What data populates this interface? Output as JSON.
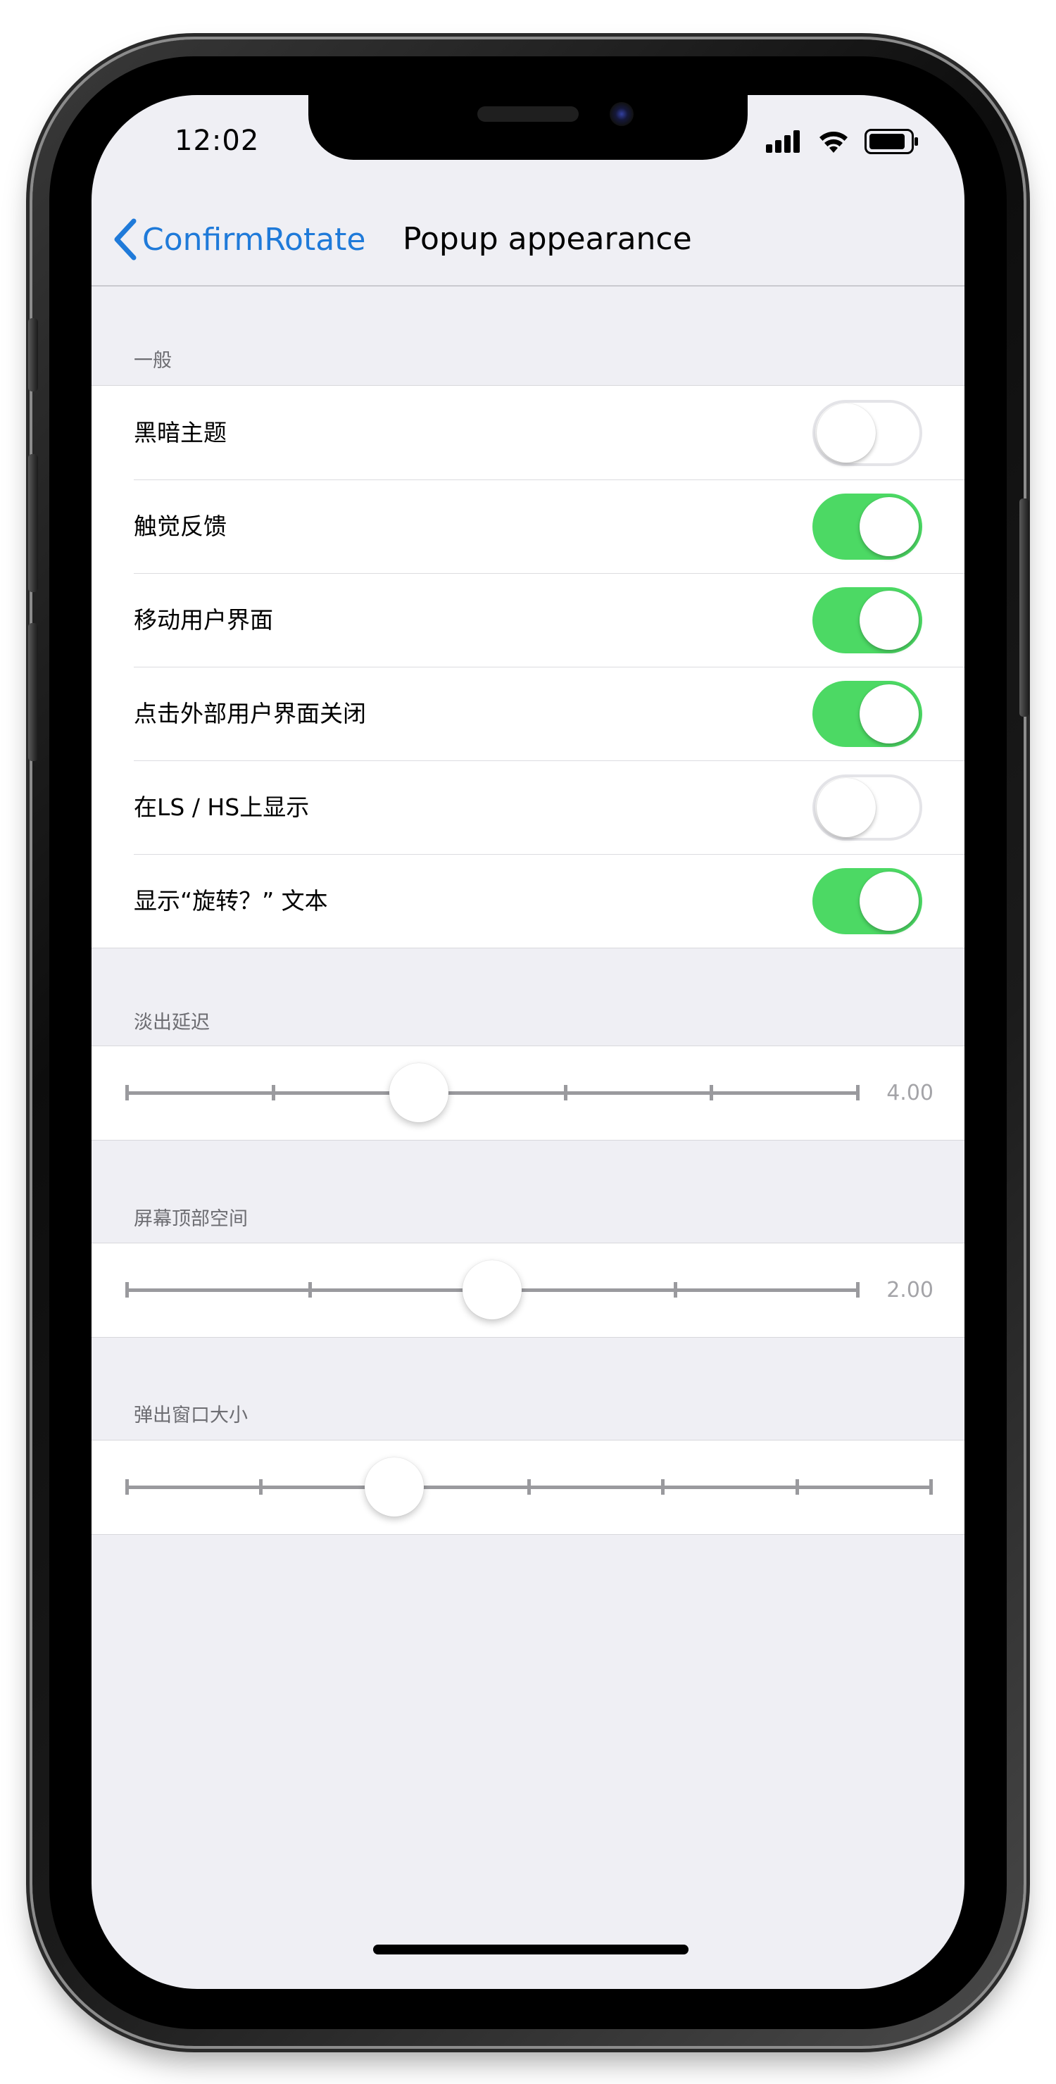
{
  "status_bar": {
    "time": "12:02"
  },
  "nav": {
    "back_label": "ConfirmRotate",
    "title": "Popup appearance"
  },
  "sections": {
    "general": {
      "header": "一般"
    },
    "fade_delay": {
      "header": "淡出延迟"
    },
    "top_space": {
      "header": "屏幕顶部空间"
    },
    "popup_size": {
      "header": "弹出窗口大小"
    }
  },
  "toggles": [
    {
      "label": "黑暗主题",
      "on": false
    },
    {
      "label": "触觉反馈",
      "on": true
    },
    {
      "label": "移动用户界面",
      "on": true
    },
    {
      "label": "点击外部用户界面关闭",
      "on": true
    },
    {
      "label": "在LS / HS上显示",
      "on": false
    },
    {
      "label": "显示“旋转？” 文本",
      "on": true
    }
  ],
  "sliders": {
    "fade_delay": {
      "value_text": "4.00",
      "value_fraction": 0.4
    },
    "top_space": {
      "value_text": "2.00",
      "value_fraction": 0.5
    },
    "popup_size": {
      "value_fraction": 0.333
    }
  },
  "colors": {
    "accent": "#1f7ad9",
    "toggle_on": "#4cd964",
    "background": "#efeff4"
  },
  "icons": [
    "chevron-left-icon",
    "signal-icon",
    "wifi-icon",
    "battery-icon"
  ]
}
